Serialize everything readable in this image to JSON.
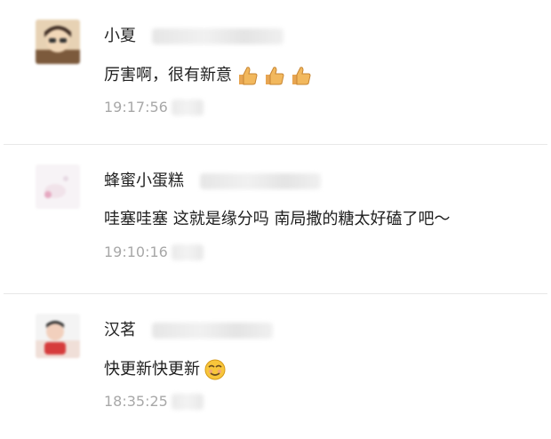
{
  "comments": [
    {
      "name": "小夏",
      "text": "厉害啊，很有新意",
      "time": "19:17:56",
      "emoji": [
        "thumbs-up-icon",
        "thumbs-up-icon",
        "thumbs-up-icon"
      ]
    },
    {
      "name": "蜂蜜小蛋糕",
      "text": "哇塞哇塞  这就是缘分吗  南局撒的糖太好磕了吧～",
      "time": "19:10:16",
      "emoji": []
    },
    {
      "name": "汉茗",
      "text": "快更新快更新",
      "time": "18:35:25",
      "emoji": [
        "grinning-face-icon"
      ]
    }
  ],
  "colors": {
    "divider": "#e8e8e8",
    "time": "#a8a8a8",
    "text": "#1f1f1f"
  }
}
